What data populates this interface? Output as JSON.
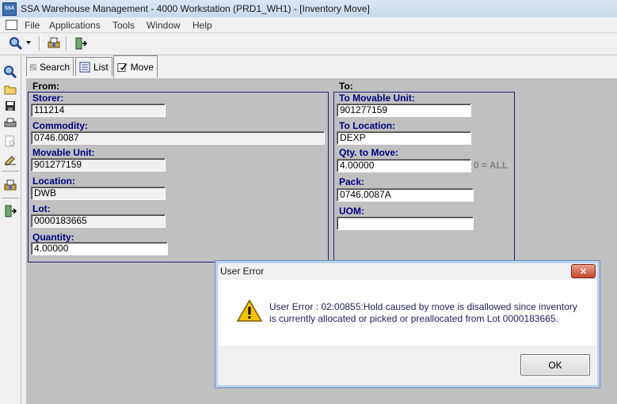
{
  "window": {
    "title": "SSA Warehouse Management - 4000 Workstation (PRD1_WH1) - [Inventory Move]",
    "app_icon_text": "SSA"
  },
  "menu": [
    "File",
    "Applications",
    "Tools",
    "Window",
    "Help"
  ],
  "tabs": [
    {
      "label": "Search"
    },
    {
      "label": "List"
    },
    {
      "label": "Move"
    }
  ],
  "from": {
    "label": "From:",
    "storer_label": "Storer:",
    "storer": "111214",
    "commodity_label": "Commodity:",
    "commodity": "0746.0087",
    "movable_unit_label": "Movable Unit:",
    "movable_unit": "901277159",
    "location_label": "Location:",
    "location": "DWB",
    "lot_label": "Lot:",
    "lot": "0000183665",
    "quantity_label": "Quantity:",
    "quantity": "4.00000"
  },
  "to": {
    "label": "To:",
    "movable_unit_label": "To Movable Unit:",
    "movable_unit": "901277159",
    "location_label": "To Location:",
    "location": "DEXP",
    "qty_label": "Qty. to Move:",
    "qty": "4.00000",
    "qty_hint": "0 = ALL",
    "pack_label": "Pack:",
    "pack": "0746.0087A",
    "uom_label": "UOM:",
    "uom": ""
  },
  "dialog": {
    "title": "User Error",
    "close_glyph": "✕",
    "message": "User Error : 02:00855:Hold caused by move is disallowed since inventory is currently allocated or picked or preallocated from Lot 0000183665.",
    "ok_label": "OK"
  },
  "colors": {
    "label_blue": "#000080",
    "group_border": "#1a1a78",
    "warning": "#f5c400"
  }
}
